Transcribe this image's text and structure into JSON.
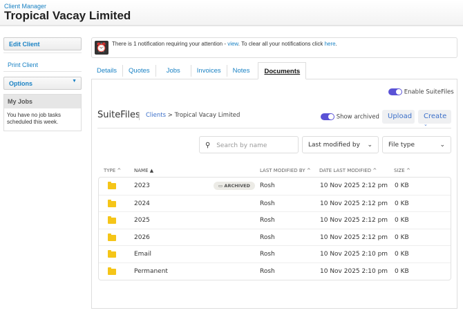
{
  "header": {
    "breadcrumb": "Client Manager",
    "title": "Tropical Vacay Limited"
  },
  "sidebar": {
    "edit": "Edit Client",
    "print": "Print Client",
    "options": "Options",
    "my_jobs_title": "My Jobs",
    "my_jobs_text": "You have no job tasks scheduled this week."
  },
  "notification": {
    "prefix": "There is 1 notification requiring your attention - ",
    "view": "view",
    "middle": ". To clear all your notifications click ",
    "here": "here",
    "suffix": "."
  },
  "tabs": [
    "Details",
    "Quotes",
    "Jobs",
    "Invoices",
    "Notes",
    "Documents"
  ],
  "suitefiles": {
    "enable_label": "Enable SuiteFiles",
    "brand": "SuiteFiles",
    "crumb_root": "Clients",
    "crumb_sep": ">",
    "crumb_current": "Tropical Vacay Limited",
    "show_archived": "Show archived",
    "upload": "Upload",
    "create": "Create",
    "search_placeholder": "Search by name",
    "filter_modified_by": "Last modified by",
    "filter_file_type": "File type",
    "columns": [
      "TYPE",
      "NAME",
      "LAST MODIFIED BY",
      "DATE LAST MODIFIED",
      "SIZE"
    ],
    "archived_label": "ARCHIVED",
    "rows": [
      {
        "name": "2023",
        "archived": true,
        "by": "Rosh",
        "date": "10 Nov 2025 2:12 pm",
        "size": "0 KB"
      },
      {
        "name": "2024",
        "by": "Rosh",
        "date": "10 Nov 2025 2:12 pm",
        "size": "0 KB"
      },
      {
        "name": "2025",
        "by": "Rosh",
        "date": "10 Nov 2025 2:12 pm",
        "size": "0 KB"
      },
      {
        "name": "2026",
        "by": "Rosh",
        "date": "10 Nov 2025 2:12 pm",
        "size": "0 KB"
      },
      {
        "name": "Email",
        "by": "Rosh",
        "date": "10 Nov 2025 2:10 pm",
        "size": "0 KB"
      },
      {
        "name": "Permanent",
        "by": "Rosh",
        "date": "10 Nov 2025 2:10 pm",
        "size": "0 KB"
      }
    ]
  }
}
